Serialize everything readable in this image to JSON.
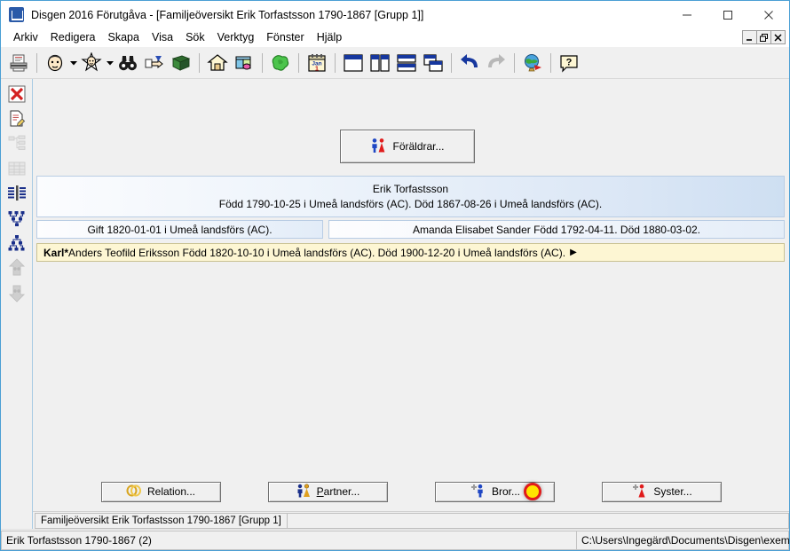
{
  "window": {
    "title": "Disgen 2016 Förutgåva - [Familjeöversikt Erik Torfastsson 1790-1867 [Grupp 1]]",
    "app_icon": "disgen-app-icon",
    "controls": {
      "minimize": "minimize-icon",
      "maximize": "maximize-icon",
      "close": "close-icon"
    },
    "mdi_controls": {
      "minimize": "mdi-minimize-icon",
      "restore": "mdi-restore-icon",
      "close": "mdi-close-icon"
    }
  },
  "menubar": {
    "items": [
      {
        "label": "Arkiv"
      },
      {
        "label": "Redigera"
      },
      {
        "label": "Skapa"
      },
      {
        "label": "Visa"
      },
      {
        "label": "Sök"
      },
      {
        "label": "Verktyg"
      },
      {
        "label": "Fönster"
      },
      {
        "label": "Hjälp"
      }
    ]
  },
  "toolbar": {
    "groups": [
      {
        "buttons": [
          {
            "icon": "print-icon"
          }
        ]
      },
      {
        "buttons": [
          {
            "icon": "person-face-icon",
            "has_dropdown": true
          },
          {
            "icon": "person-star-icon",
            "has_dropdown": true
          },
          {
            "icon": "binoculars-icon"
          },
          {
            "icon": "pointing-hand-icon"
          },
          {
            "icon": "book-icon"
          }
        ]
      },
      {
        "buttons": [
          {
            "icon": "home-icon"
          },
          {
            "icon": "gift-box-icon"
          }
        ]
      },
      {
        "buttons": [
          {
            "icon": "map-green-icon"
          }
        ]
      },
      {
        "buttons": [
          {
            "icon": "calendar-jan1-icon"
          }
        ]
      },
      {
        "buttons": [
          {
            "icon": "window-single-icon"
          },
          {
            "icon": "window-vertical-split-icon"
          },
          {
            "icon": "window-horizontal-split-icon"
          },
          {
            "icon": "window-cascade-icon"
          }
        ]
      },
      {
        "buttons": [
          {
            "icon": "undo-icon"
          },
          {
            "icon": "redo-icon"
          }
        ]
      },
      {
        "buttons": [
          {
            "icon": "globe-icon"
          }
        ]
      },
      {
        "buttons": [
          {
            "icon": "help-question-icon"
          }
        ]
      }
    ]
  },
  "sidebar": {
    "items": [
      {
        "icon": "close-red-x-icon",
        "enabled": true
      },
      {
        "icon": "document-edit-icon",
        "enabled": true
      },
      {
        "icon": "tree-chart-icon",
        "enabled": false
      },
      {
        "icon": "table-grid-icon",
        "enabled": false
      },
      {
        "icon": "family-overview-icon",
        "enabled": true
      },
      {
        "icon": "ancestor-chart-icon",
        "enabled": true
      },
      {
        "icon": "descendant-chart-icon",
        "enabled": true
      },
      {
        "icon": "navigate-up-icon",
        "enabled": false
      },
      {
        "icon": "navigate-down-icon",
        "enabled": false
      }
    ]
  },
  "main": {
    "parents_button": {
      "label": "Föräldrar...",
      "icon": "man-woman-pair-icon"
    },
    "person": {
      "name": "Erik Torfastsson",
      "details": "Född 1790-10-25 i Umeå landsförs (AC). Död 1867-08-26 i Umeå landsförs (AC)."
    },
    "marriage": {
      "text": "Gift 1820-01-01 i Umeå landsförs (AC)."
    },
    "spouse": {
      "text": "Amanda Elisabet Sander Född 1792-04-11. Död 1880-03-02."
    },
    "children": [
      {
        "name_bold": "Karl*",
        "rest": " Anders Teofild Eriksson Född 1820-10-10 i Umeå landsförs (AC). Död 1900-12-20 i Umeå landsförs (AC).",
        "expander": "▶"
      }
    ]
  },
  "actions": {
    "relation": {
      "label": "Relation...",
      "icon": "rings-icon"
    },
    "partner": {
      "label_pre": "",
      "label_underline": "P",
      "label_post": "artner...",
      "icon": "couple-icon"
    },
    "brother": {
      "label": "Bror...",
      "icon": "add-man-icon",
      "cursor_marker": "yellow-cursor-highlight"
    },
    "sister": {
      "label": "Syster...",
      "icon": "add-woman-icon"
    }
  },
  "statusbar": {
    "tab_label": "Familjeöversikt Erik Torfastsson 1790-1867 [Grupp 1]",
    "selection": "Erik Torfastsson 1790-1867 (2)",
    "database_path": "C:\\Users\\Ingegärd\\Documents\\Disgen\\exempel"
  },
  "colors": {
    "accent_blue": "#2a5aa8",
    "card_blue": "#cedff2",
    "child_yellow": "#fdf6d3",
    "cursor_yellow": "#ffe400",
    "cursor_red": "#e01b1b",
    "window_border": "#4a9fd4"
  }
}
